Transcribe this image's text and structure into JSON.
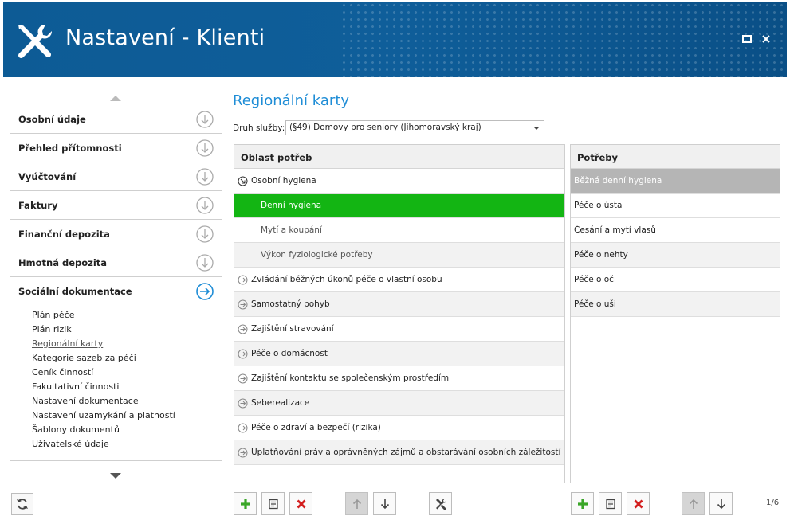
{
  "window": {
    "title": "Nastavení - Klienti"
  },
  "nav": {
    "items": [
      {
        "label": "Osobní údaje"
      },
      {
        "label": "Přehled přítomnosti"
      },
      {
        "label": "Vyúčtování"
      },
      {
        "label": "Faktury"
      },
      {
        "label": "Finanční depozita"
      },
      {
        "label": "Hmotná depozita"
      },
      {
        "label": "Sociální dokumentace"
      }
    ],
    "subitems": [
      {
        "label": "Plán péče"
      },
      {
        "label": "Plán rizik"
      },
      {
        "label": "Regionální karty"
      },
      {
        "label": "Kategorie sazeb za péči"
      },
      {
        "label": "Ceník činností"
      },
      {
        "label": "Fakultativní činnosti"
      },
      {
        "label": "Nastavení dokumentace"
      },
      {
        "label": "Nastavení uzamykání a platností"
      },
      {
        "label": "Šablony dokumentů"
      },
      {
        "label": "Uživatelské údaje"
      }
    ]
  },
  "main": {
    "title": "Regionální karty",
    "druh_label": "Druh služby:",
    "druh_value": "(§49) Domovy pro seniory (Jihomoravský kraj)"
  },
  "left_panel": {
    "header": "Oblast potřeb",
    "rows": [
      {
        "label": "Osobní hygiena"
      },
      {
        "label": "Denní hygiena"
      },
      {
        "label": "Mytí a koupání"
      },
      {
        "label": "Výkon fyziologické potřeby"
      },
      {
        "label": "Zvládání běžných úkonů péče o vlastní osobu"
      },
      {
        "label": "Samostatný pohyb"
      },
      {
        "label": "Zajištění stravování"
      },
      {
        "label": "Péče o domácnost"
      },
      {
        "label": "Zajištění kontaktu se společenským prostředím"
      },
      {
        "label": "Seberealizace"
      },
      {
        "label": "Péče o zdraví a bezpečí (rizika)"
      },
      {
        "label": "Uplatňování práv a oprávněných zájmů a obstarávání osobních záležitostí"
      }
    ]
  },
  "right_panel": {
    "header": "Potřeby",
    "rows": [
      {
        "label": "Běžná denní hygiena"
      },
      {
        "label": "Péče o ústa"
      },
      {
        "label": "Česání a mytí vlasů"
      },
      {
        "label": "Péče o nehty"
      },
      {
        "label": "Péče o oči"
      },
      {
        "label": "Péče o uši"
      }
    ]
  },
  "pager": "1/6",
  "colors": {
    "header_bg": "#0f5e9a",
    "accent": "#1f8dd6",
    "selected_row": "#13b513",
    "add_icon": "#3aa628",
    "delete_icon": "#d31f1f"
  }
}
